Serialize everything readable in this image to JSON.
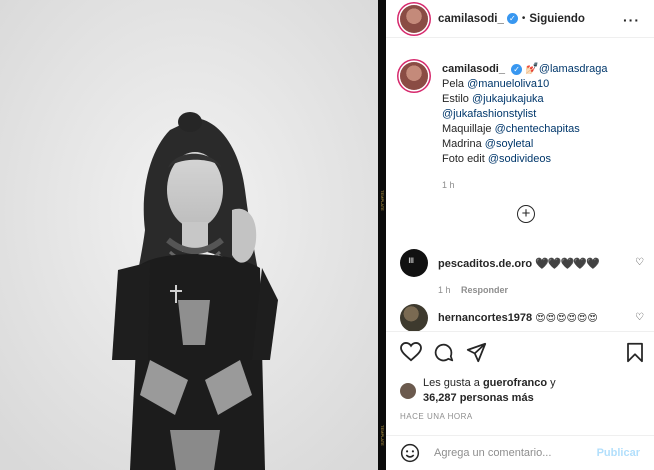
{
  "header": {
    "username": "camilasodi_",
    "separator": "•",
    "follow_status": "Siguiendo",
    "more": "···"
  },
  "caption": {
    "username": "camilasodi_",
    "emoji": "💅🏻",
    "lines": [
      {
        "text": "@lamasdraga",
        "link": true
      },
      {
        "prefix": "Pela ",
        "link_text": "@manueloliva10"
      },
      {
        "prefix": "Estilo ",
        "link_text": "@jukajukajuka"
      },
      {
        "prefix": "",
        "link_text": "@jukafashionstylist"
      },
      {
        "prefix": "Maquillaje ",
        "link_text": "@chentechapitas"
      },
      {
        "prefix": "Madrina ",
        "link_text": "@soyletal"
      },
      {
        "prefix": "Foto edit ",
        "link_text": "@sodivideos"
      }
    ],
    "time": "1 h"
  },
  "load_more": "+",
  "comments": [
    {
      "username": "pescaditos.de.oro",
      "text": "🖤🖤🖤🖤🖤",
      "time": "1 h",
      "reply": "Responder"
    },
    {
      "username": "hernancortes1978",
      "text": "😍😍😍😍😍😍"
    }
  ],
  "likes": {
    "prefix": "Les gusta a ",
    "user": "guerofranco",
    "connector": " y",
    "count_text": "36,287 personas más"
  },
  "time_ago": "HACE UNA HORA",
  "add_comment": {
    "placeholder": "Agrega un comentario...",
    "publish": "Publicar"
  },
  "sidebar_marks": [
    "TEMPLATE",
    "TEMPLATE"
  ]
}
